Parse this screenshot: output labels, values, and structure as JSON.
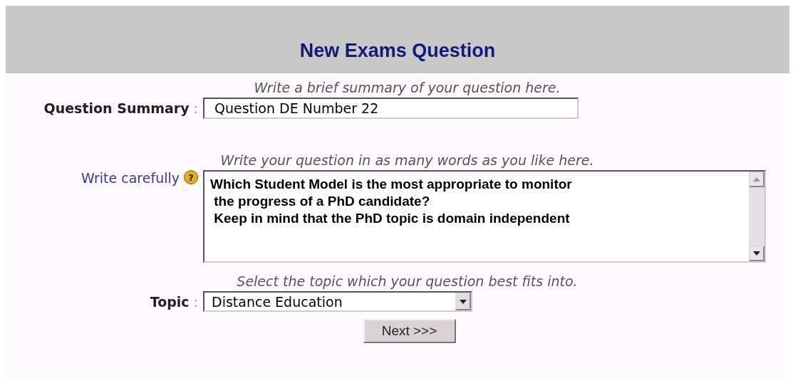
{
  "header": {
    "title": "New Exams Question"
  },
  "summary": {
    "hint": "Write a brief summary of your question here.",
    "label": "Question Summary",
    "separator": ":",
    "value": "Question DE Number 22"
  },
  "question": {
    "hint": "Write your question in as many words as you like here.",
    "label": "Write carefully",
    "help_icon": "?",
    "value": "Which Student Model is the most appropriate to monitor\n the progress of a PhD candidate?\n Keep in mind that the PhD topic is domain independent"
  },
  "topic": {
    "hint": "Select the topic which your question best fits into.",
    "label": "Topic",
    "separator": ":",
    "value": "Distance Education"
  },
  "next_button": {
    "label": "Next >>>"
  }
}
